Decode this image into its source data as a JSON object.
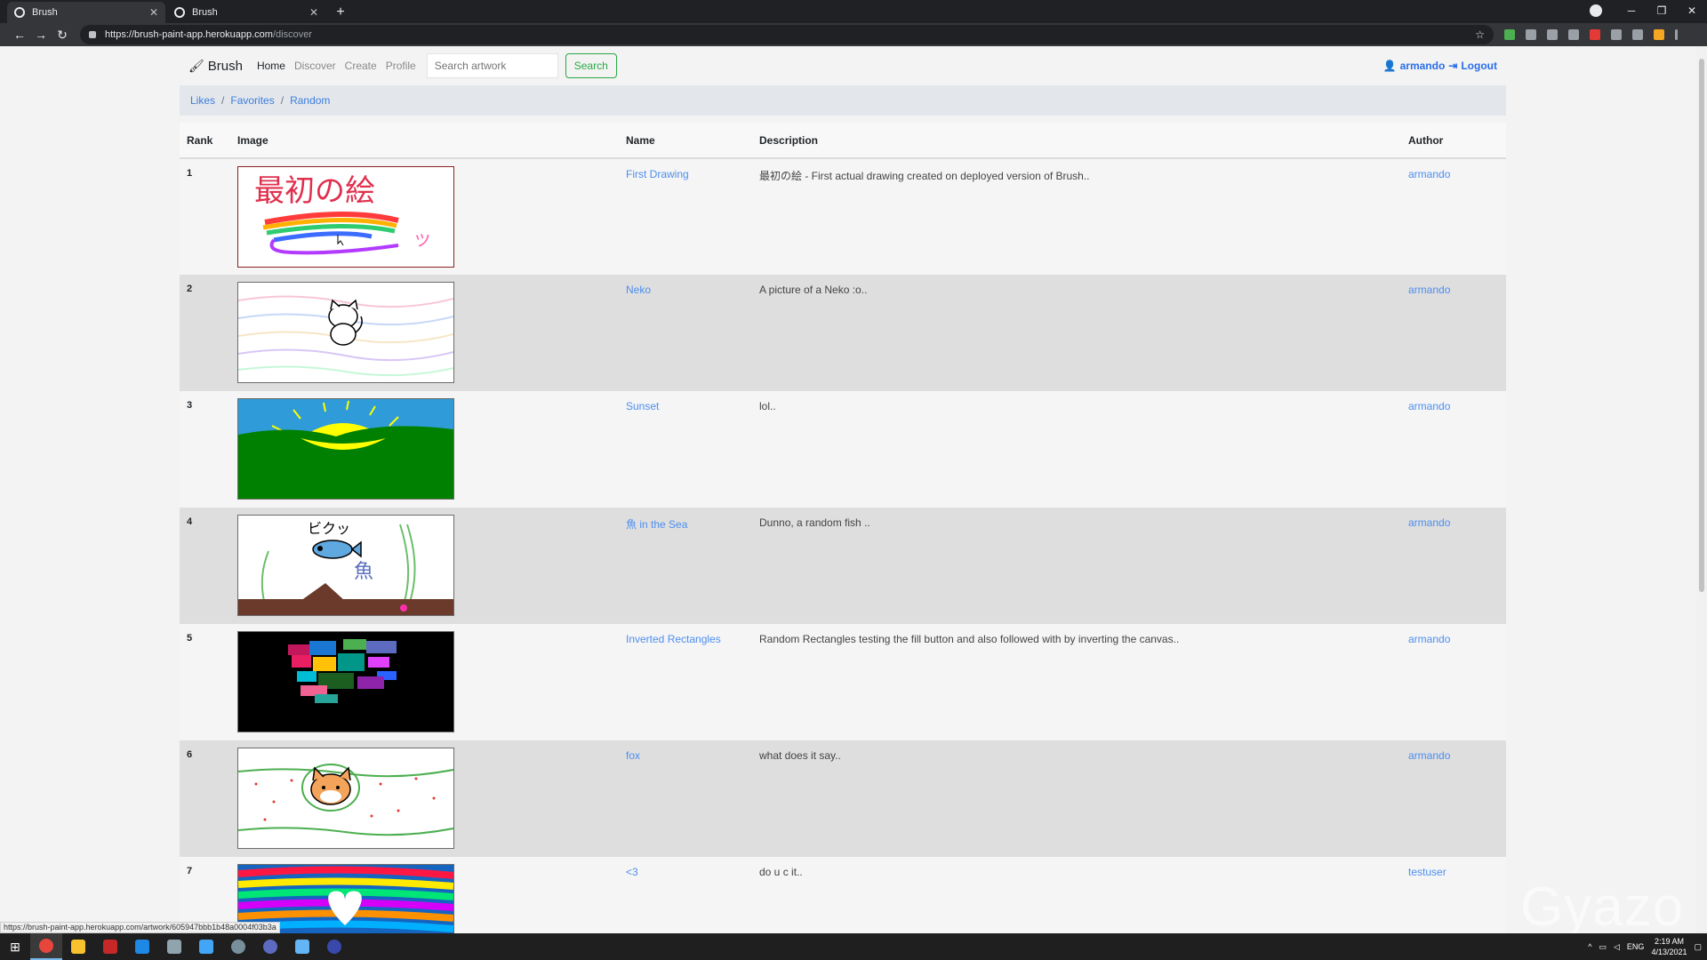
{
  "browser": {
    "tabs": [
      {
        "title": "Brush",
        "active": true
      },
      {
        "title": "Brush",
        "active": false
      }
    ],
    "url_host": "https://brush-paint-app.herokuapp.com",
    "url_path": "/discover",
    "status_url": "https://brush-paint-app.herokuapp.com/artwork/605947bbb1b48a0004f03b3a"
  },
  "navbar": {
    "brand": "Brush",
    "links": [
      "Home",
      "Discover",
      "Create",
      "Profile"
    ],
    "search_placeholder": "Search artwork",
    "search_button": "Search",
    "user": "armando",
    "logout": "Logout"
  },
  "breadcrumb": [
    "Likes",
    "Favorites",
    "Random"
  ],
  "table": {
    "headers": [
      "Rank",
      "Image",
      "Name",
      "Description",
      "Author"
    ],
    "rows": [
      {
        "rank": "1",
        "name": "First Drawing",
        "description": "最初の絵 - First actual drawing created on deployed version of Brush..",
        "author": "armando"
      },
      {
        "rank": "2",
        "name": "Neko",
        "description": "A picture of a Neko :o..",
        "author": "armando"
      },
      {
        "rank": "3",
        "name": "Sunset",
        "description": "lol..",
        "author": "armando"
      },
      {
        "rank": "4",
        "name": "魚 in the Sea",
        "description": "Dunno, a random fish ..",
        "author": "armando"
      },
      {
        "rank": "5",
        "name": "Inverted Rectangles",
        "description": "Random Rectangles testing the fill button and also followed with by inverting the canvas..",
        "author": "armando"
      },
      {
        "rank": "6",
        "name": "fox",
        "description": "what does it say..",
        "author": "armando"
      },
      {
        "rank": "7",
        "name": "<3",
        "description": "do u c it..",
        "author": "testuser"
      }
    ]
  },
  "artwork_text": {
    "first_drawing": "最初の絵",
    "first_drawing_tail": "ッ",
    "fish_sound": "ビクッ",
    "fish_kanji": "魚"
  },
  "taskbar": {
    "lang": "ENG",
    "time": "2:19 AM",
    "date": "4/13/2021"
  },
  "watermark": "Gyazo",
  "colors": {
    "accent": "#4c8ef0",
    "search_green": "#28a745"
  }
}
